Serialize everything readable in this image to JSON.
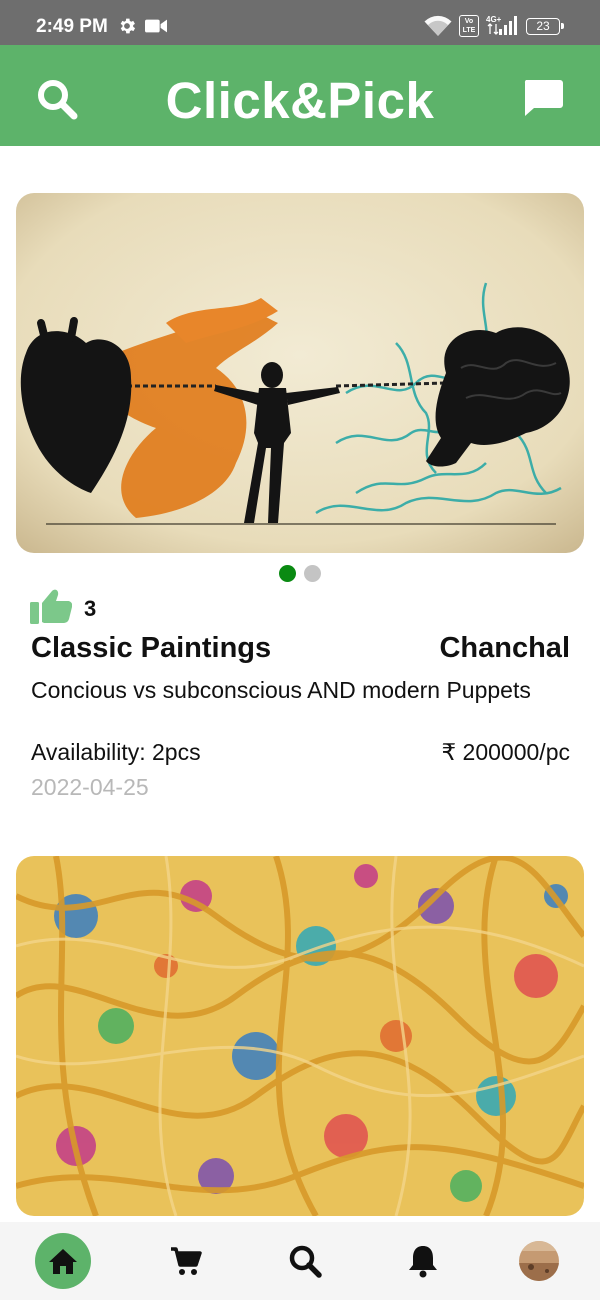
{
  "status_bar": {
    "time": "2:49 PM",
    "volte": "Vo LTE",
    "network": "4G+",
    "battery": "23",
    "icons": [
      "gear-icon",
      "video-camera-icon",
      "wifi-icon",
      "signal-icon",
      "battery-icon"
    ]
  },
  "app_bar": {
    "title": "Click&Pick",
    "icons": [
      "search-icon",
      "chat-icon"
    ],
    "color": "#5db36a"
  },
  "posts": [
    {
      "likes": "3",
      "category": "Classic Paintings",
      "artist": "Chanchal",
      "description": "Concious vs subconscious AND modern Puppets",
      "availability": "Availability: 2pcs",
      "price": "₹ 200000/pc",
      "date": "2022-04-25",
      "image_pages": 2,
      "active_page": 1
    }
  ],
  "bottom_nav": {
    "items": [
      "home-icon",
      "cart-icon",
      "search-icon",
      "bell-icon",
      "avatar"
    ],
    "active": "home",
    "active_color": "#5db36a",
    "inactive_dot_color": "#c4c4c4",
    "indicator_color": "#0a8a12"
  }
}
